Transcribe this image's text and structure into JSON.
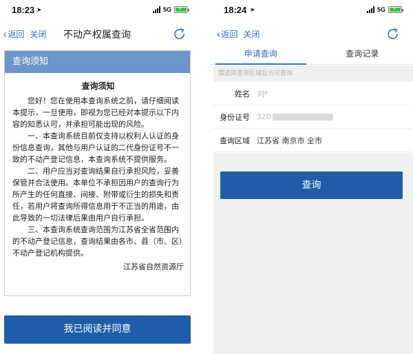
{
  "left": {
    "status": {
      "time": "18:23",
      "network": "5G"
    },
    "nav": {
      "back": "返回",
      "close": "关闭",
      "title": "不动产权属查询"
    },
    "notice": {
      "header": "查询须知",
      "title": "查询须知",
      "paragraphs": [
        "您好！您在使用本查询系统之前，请仔细阅读本提示，一旦使用，即视为您已经对本提示以下内容的知悉认可，并承担可能出现的风险。",
        "一、本查询系统目前仅支持以权利人认证的身份信息查询，其他与用户认证的二代身份证号不一致的不动产登记信息，本查询系统不提供服务。",
        "二、用户应当对查询结果自行承担风险，妥善保管并合法使用。本单位不承担因用户的查询行为所产生的任何直接、间接、附带或衍生的损失和责任，若用户将查询所得信息用于不正当的用途，由此导致的一切法律后果由用户自行承担。",
        "三、本查询系统查询范围为江苏省全省范围内的不动产登记信息，查询结果由各市、县（市、区）不动产登记机构提供。"
      ],
      "signature": "江苏省自然资源厅"
    },
    "agree_button": "我已阅读并同意"
  },
  "right": {
    "status": {
      "time": "18:24",
      "network": "5G"
    },
    "nav": {
      "back": "返回",
      "close": "关闭"
    },
    "tabs": [
      {
        "label": "申请查询",
        "active": true
      },
      {
        "label": "查询记录",
        "active": false
      }
    ],
    "hint": "需选择查询区域后方可查询",
    "form": {
      "name_label": "姓名",
      "name_value": "刘*",
      "id_label": "身份证号",
      "id_value": "320",
      "region_label": "查询区域",
      "region_value": "江苏省 南京市 全市"
    },
    "query_button": "查询"
  },
  "colors": {
    "accent": "#2f6fc4",
    "button": "#1f5da8",
    "header": "#6a96c9",
    "battery": "#36c24a"
  }
}
